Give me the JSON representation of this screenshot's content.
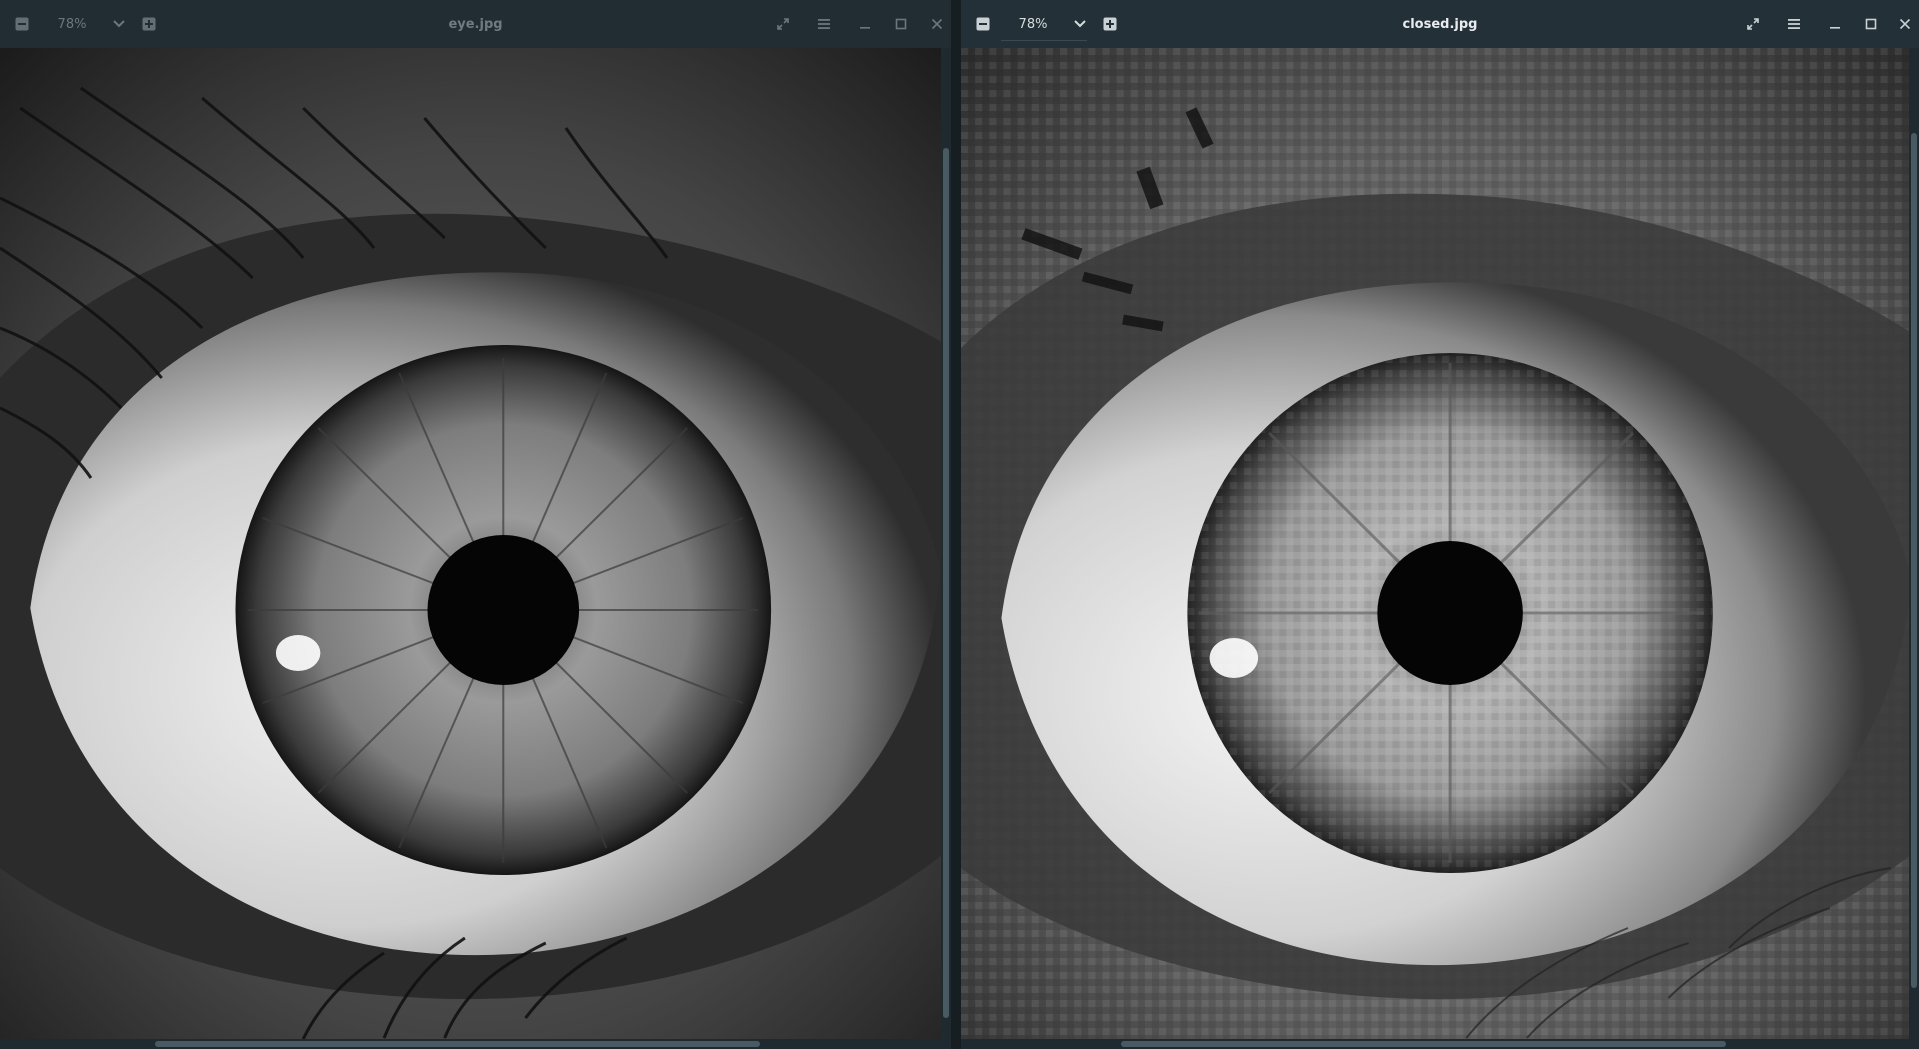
{
  "left_window": {
    "title": "eye.jpg",
    "zoom": "78%",
    "state": "inactive",
    "image_subject": "eye-photo",
    "icons": [
      "zoom-out-icon",
      "chevron-down-icon",
      "zoom-in-icon",
      "fullscreen-icon",
      "menu-icon",
      "minimize-icon",
      "maximize-icon",
      "close-icon"
    ],
    "hscroll_fraction": 0.64,
    "vscroll_fraction": 0.86
  },
  "right_window": {
    "title": "closed.jpg",
    "zoom": "78%",
    "state": "active",
    "image_subject": "eye-photo-blocky",
    "icons": [
      "zoom-out-icon",
      "chevron-down-icon",
      "zoom-in-icon",
      "fullscreen-icon",
      "menu-icon",
      "minimize-icon",
      "maximize-icon",
      "close-icon"
    ],
    "hscroll_fraction": 0.64,
    "vscroll_fraction": 0.86
  },
  "colors": {
    "headerbar": "#233037",
    "canvas": "#0d0d0d",
    "scroll_thumb": "#4a5a62"
  }
}
